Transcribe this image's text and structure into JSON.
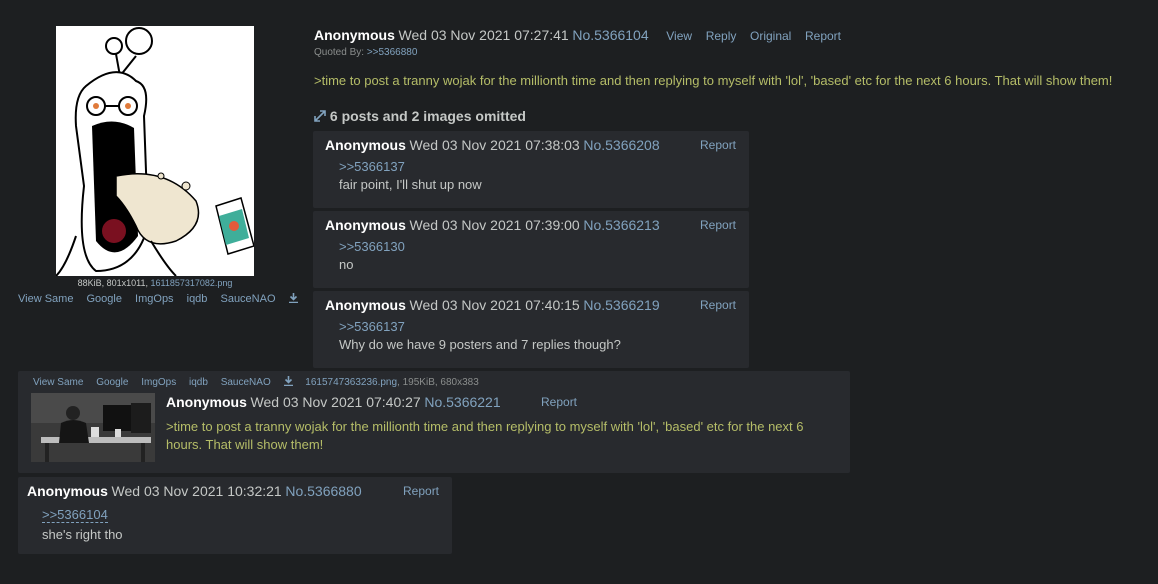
{
  "op": {
    "file_info_prefix": "88KiB, 801x1011, ",
    "file_name": "1611857317082.png",
    "tools": [
      "View Same",
      "Google",
      "ImgOps",
      "iqdb",
      "SauceNAO"
    ],
    "name": "Anonymous",
    "date": "Wed 03 Nov 2021 07:27:41",
    "post_no": "No.5366104",
    "actions": [
      "View",
      "Reply",
      "Original",
      "Report"
    ],
    "quoted_by_label": "Quoted By:",
    "quoted_by_link": ">>5366880",
    "body": ">time to post a tranny wojak for the millionth time and then replying to myself with 'lol', 'based' etc for the next 6 hours. That will show them!"
  },
  "omitted_text": "6 posts and 2 images omitted",
  "replies": [
    {
      "name": "Anonymous",
      "date": "Wed 03 Nov 2021 07:38:03",
      "post_no": "No.5366208",
      "report": "Report",
      "quote": ">>5366137",
      "message": "fair point, I'll shut up now"
    },
    {
      "name": "Anonymous",
      "date": "Wed 03 Nov 2021 07:39:00",
      "post_no": "No.5366213",
      "report": "Report",
      "quote": ">>5366130",
      "message": "no"
    },
    {
      "name": "Anonymous",
      "date": "Wed 03 Nov 2021 07:40:15",
      "post_no": "No.5366219",
      "report": "Report",
      "quote": ">>5366137",
      "message": "Why do we have 9 posters and 7 replies though?"
    },
    {
      "tools": [
        "View Same",
        "Google",
        "ImgOps",
        "iqdb",
        "SauceNAO"
      ],
      "file_name": "1615747363236.png",
      "file_info": ", 195KiB, 680x383",
      "name": "Anonymous",
      "date": "Wed 03 Nov 2021 07:40:27",
      "post_no": "No.5366221",
      "report": "Report",
      "body": ">time to post a tranny wojak for the millionth time and then replying to myself with 'lol', 'based' etc for the next 6 hours. That will show them!"
    },
    {
      "name": "Anonymous",
      "date": "Wed 03 Nov 2021 10:32:21",
      "post_no": "No.5366880",
      "report": "Report",
      "quote": ">>5366104",
      "message": "she's right tho"
    }
  ],
  "colors": {
    "background": "#1d1f21",
    "post_background": "#282a2e",
    "link": "#81a2be",
    "greentext": "#b5bd68",
    "name": "#ffffff"
  }
}
